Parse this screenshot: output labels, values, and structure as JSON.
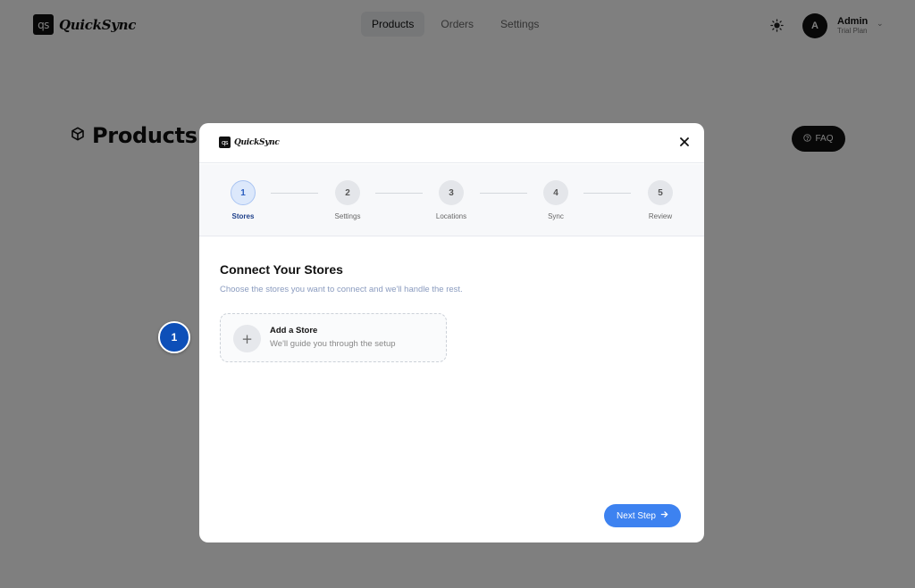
{
  "app": {
    "brand_mark": "qs",
    "brand_name": "QuickSync"
  },
  "nav": {
    "items": [
      {
        "label": "Products",
        "active": true
      },
      {
        "label": "Orders",
        "active": false
      },
      {
        "label": "Settings",
        "active": false
      }
    ]
  },
  "header": {
    "theme_icon": "sun-icon",
    "user": {
      "avatar_initial": "A",
      "name": "Admin",
      "plan": "Trial Plan"
    }
  },
  "page": {
    "title": "Products",
    "title_icon": "cube-icon",
    "faq_label": "FAQ"
  },
  "tour": {
    "step_badge": "1"
  },
  "modal": {
    "brand_mark": "qs",
    "brand_name": "QuickSync",
    "close_icon": "close-icon",
    "steps": [
      {
        "number": "1",
        "label": "Stores",
        "active": true
      },
      {
        "number": "2",
        "label": "Settings",
        "active": false
      },
      {
        "number": "3",
        "label": "Locations",
        "active": false
      },
      {
        "number": "4",
        "label": "Sync",
        "active": false
      },
      {
        "number": "5",
        "label": "Review",
        "active": false
      }
    ],
    "content": {
      "title": "Connect Your Stores",
      "subtitle": "Choose the stores you want to connect and we'll handle the rest.",
      "add_store": {
        "title": "Add a Store",
        "subtitle": "We'll guide you through the setup"
      }
    },
    "next_button": "Next Step"
  },
  "colors": {
    "accent": "#3d82f0",
    "badge": "#0d4fb8",
    "overlay": "rgba(0,0,0,0.5)"
  }
}
